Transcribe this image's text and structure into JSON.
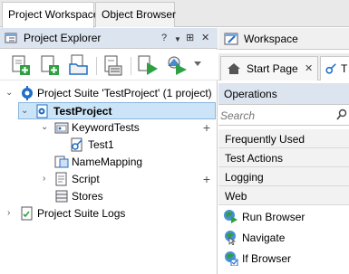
{
  "top_tabs": [
    {
      "label": "Project Workspace",
      "active": true
    },
    {
      "label": "Object Browser",
      "active": false
    }
  ],
  "project_explorer": {
    "title": "Project Explorer",
    "header_controls": {
      "help": "?",
      "menu": "▼",
      "pin": "⊞",
      "close": "✕"
    },
    "toolbar_icons": [
      "add-new-project-item-icon",
      "add-item-icon",
      "add-existing-item-icon",
      "add-to-source-control-icon",
      "run-icon",
      "run-options-icon",
      "dropdown-icon"
    ],
    "tree": [
      {
        "label": "Project Suite 'TestProject' (1 project)",
        "level": 0,
        "expander": "⌄",
        "icon": "project-suite-icon"
      },
      {
        "label": "TestProject",
        "level": 1,
        "expander": "⌄",
        "icon": "project-icon",
        "selected": true
      },
      {
        "label": "KeywordTests",
        "level": 2,
        "expander": "⌄",
        "icon": "keyword-tests-folder-icon",
        "plus": "+"
      },
      {
        "label": "Test1",
        "level": 3,
        "expander": "",
        "icon": "keyword-test-icon"
      },
      {
        "label": "NameMapping",
        "level": 2,
        "expander": "",
        "icon": "name-mapping-icon"
      },
      {
        "label": "Script",
        "level": 2,
        "expander": "›",
        "icon": "script-icon",
        "plus": "+"
      },
      {
        "label": "Stores",
        "level": 2,
        "expander": "",
        "icon": "stores-icon"
      },
      {
        "label": "Project Suite Logs",
        "level": 0,
        "expander": "›",
        "icon": "logs-icon"
      }
    ]
  },
  "workspace": {
    "title": "Workspace",
    "tabs": [
      {
        "label": "Start Page",
        "icon": "home-icon",
        "close": "✕"
      },
      {
        "label": "T",
        "icon": "keyword-test-icon"
      }
    ],
    "operations": {
      "title": "Operations",
      "search_placeholder": "Search",
      "categories": [
        "Frequently Used",
        "Test Actions",
        "Logging",
        "Web"
      ],
      "items": [
        {
          "label": "Run Browser",
          "icon": "run-browser-icon"
        },
        {
          "label": "Navigate",
          "icon": "navigate-icon"
        },
        {
          "label": "If Browser",
          "icon": "if-browser-icon"
        }
      ]
    }
  },
  "colors": {
    "panel_header_bg": "#dce4f0",
    "selection_bg": "#cce4f7",
    "green": "#2ea043",
    "blue": "#1e6fc8"
  }
}
